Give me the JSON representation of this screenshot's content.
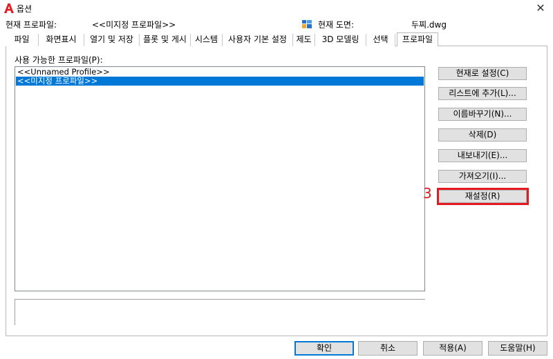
{
  "window": {
    "title": "옵션",
    "close_glyph": "✕",
    "icon": "autocad-a-icon",
    "accent_color": "#0078d7",
    "annotation_color": "#e5191f"
  },
  "profile_row": {
    "current_profile_label": "현재 프로파일:",
    "current_profile_value": "<<미지정 프로파일>>",
    "drawing_icon": "drawing-file-icon",
    "current_drawing_label": "현재 도면:",
    "current_drawing_value": "두찌.dwg"
  },
  "tabs": [
    {
      "label": "파일"
    },
    {
      "label": "화면표시"
    },
    {
      "label": "열기 및 저장"
    },
    {
      "label": "플롯 및 게시"
    },
    {
      "label": "시스템"
    },
    {
      "label": "사용자 기본 설정"
    },
    {
      "label": "제도"
    },
    {
      "label": "3D 모델링"
    },
    {
      "label": "선택"
    },
    {
      "label": "프로파일",
      "active": true
    }
  ],
  "profiles": {
    "label": "사용 가능한 프로파일(P):",
    "items": [
      {
        "label": "<<Unnamed Profile>>",
        "selected": false
      },
      {
        "label": "<<미지정 프로파일>>",
        "selected": true
      }
    ]
  },
  "side_buttons": [
    {
      "label": "현재로 설정(C)"
    },
    {
      "label": "리스트에 추가(L)..."
    },
    {
      "label": "이름바꾸기(N)..."
    },
    {
      "label": "삭제(D)"
    },
    {
      "label": "내보내기(E)..."
    },
    {
      "label": "가져오기(I)..."
    },
    {
      "label": "재설정(R)"
    }
  ],
  "annotation": {
    "number": "3"
  },
  "dialog_buttons": {
    "ok": "확인",
    "cancel": "취소",
    "apply": "적용(A)",
    "help": "도움말(H)"
  }
}
